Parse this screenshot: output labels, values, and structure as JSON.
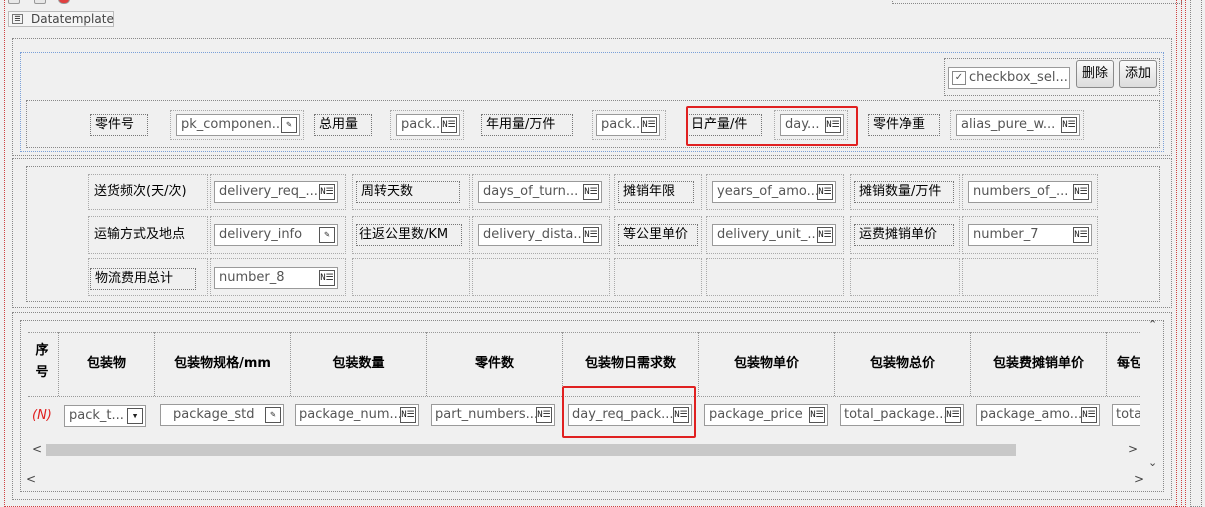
{
  "window": {
    "title": "Datatemplate"
  },
  "toolbar": {
    "checkbox_label": "checkbox_sel...",
    "delete_label": "删除",
    "add_label": "添加"
  },
  "row1": [
    {
      "label": "零件号",
      "field": "pk_componen...",
      "icon": "edit"
    },
    {
      "label": "总用量",
      "field": "pack...",
      "icon": "number"
    },
    {
      "label": "年用量/万件",
      "field": "pack...",
      "icon": "number"
    },
    {
      "label": "日产量/件",
      "field": "day...",
      "icon": "number"
    },
    {
      "label": "零件净重",
      "field": "alias_pure_w...",
      "icon": "number"
    }
  ],
  "row2": [
    {
      "label": "送货频次(天/次)",
      "field": "delivery_req_...",
      "icon": "number"
    },
    {
      "label": "周转天数",
      "field": "days_of_turn...",
      "icon": "number"
    },
    {
      "label": "摊销年限",
      "field": "years_of_amo...",
      "icon": "number"
    },
    {
      "label": "摊销数量/万件",
      "field": "numbers_of_...",
      "icon": "number"
    }
  ],
  "row3": [
    {
      "label": "运输方式及地点",
      "field": "delivery_info",
      "icon": "edit"
    },
    {
      "label": "往返公里数/KM",
      "field": "delivery_dista...",
      "icon": "number"
    },
    {
      "label": "等公里单价",
      "field": "delivery_unit_...",
      "icon": "number"
    },
    {
      "label": "运费摊销单价",
      "field": "number_7",
      "icon": "number"
    }
  ],
  "row4": [
    {
      "label": "物流费用总计",
      "field": "number_8",
      "icon": "number"
    }
  ],
  "grid": {
    "seq_header": "序号",
    "new_row_marker": "(N)",
    "columns": [
      {
        "header": "包装物",
        "field": "pack_t...",
        "icon": "dropdown"
      },
      {
        "header": "包装物规格/mm",
        "field": "package_std",
        "icon": "edit"
      },
      {
        "header": "包装数量",
        "field": "package_num...",
        "icon": "number"
      },
      {
        "header": "零件数",
        "field": "part_numbers...",
        "icon": "number"
      },
      {
        "header": "包装物日需求数",
        "field": "day_req_pack...",
        "icon": "number"
      },
      {
        "header": "包装物单价",
        "field": "package_price",
        "icon": "number"
      },
      {
        "header": "包装物总价",
        "field": "total_package...",
        "icon": "number"
      },
      {
        "header": "包装费摊销单价",
        "field": "package_amo...",
        "icon": "number"
      },
      {
        "header": "每包",
        "field": "tota",
        "icon": ""
      }
    ]
  },
  "icons": {
    "number": "N☰",
    "edit": "✎",
    "dropdown": "▾"
  },
  "colors": {
    "highlight": "#e02020",
    "background": "#f0f0f0"
  }
}
